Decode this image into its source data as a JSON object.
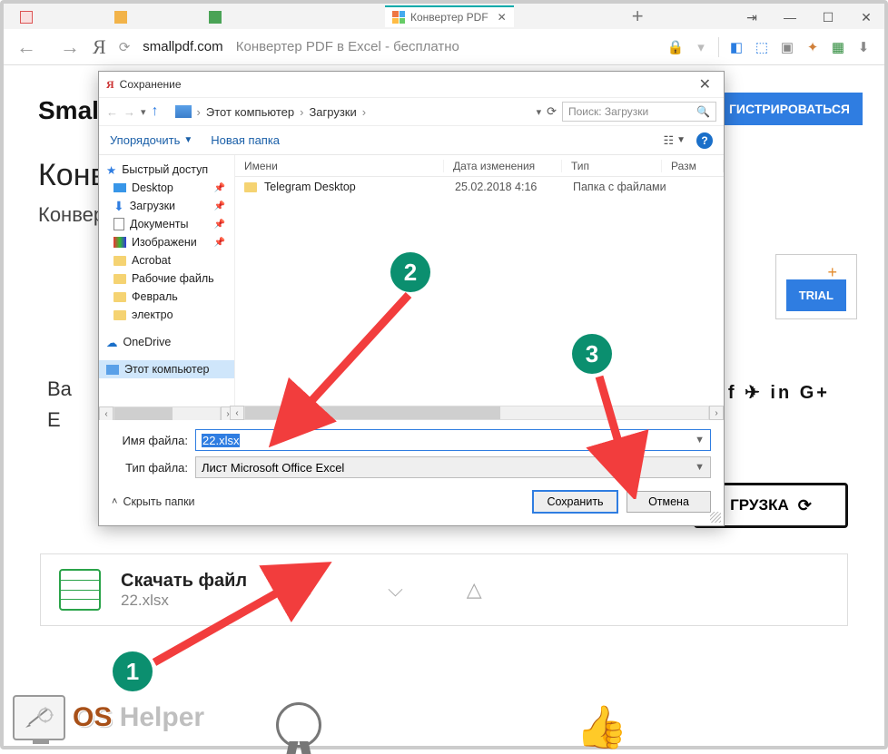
{
  "browser": {
    "active_tab": "Конвертер PDF",
    "url_domain": "smallpdf.com",
    "url_title": "Конвертер PDF в Excel - бесплатно",
    "window_controls": {
      "arrows": "↹",
      "min": "—",
      "max": "☐",
      "close": "✕"
    }
  },
  "page": {
    "brand": "Smallp",
    "register": "ГИСТРИРОВАТЬСЯ",
    "headline": "Конв",
    "subline": "Конвер",
    "trial": "TRIAL",
    "conv_label_1": "Ва",
    "conv_label_2": "E",
    "social": "f ✈ in G+",
    "load": "ГРУЗКА",
    "dl_title": "Скачать файл",
    "dl_file": "22.xlsx"
  },
  "dialog": {
    "title": "Сохранение",
    "breadcrumb": {
      "root": "Этот компьютер",
      "folder": "Загрузки"
    },
    "search_placeholder": "Поиск: Загрузки",
    "organize": "Упорядочить",
    "new_folder": "Новая папка",
    "columns": {
      "name": "Имени",
      "date": "Дата изменения",
      "type": "Тип",
      "size": "Разм"
    },
    "row": {
      "name": "Telegram Desktop",
      "date": "25.02.2018 4:16",
      "type": "Папка с файлами"
    },
    "tree": {
      "quick": "Быстрый доступ",
      "desktop": "Desktop",
      "downloads": "Загрузки",
      "documents": "Документы",
      "images": "Изображени",
      "acrobat": "Acrobat",
      "work": "Рабочие файль",
      "feb": "Февраль",
      "electro": "электро",
      "onedrive": "OneDrive",
      "thispc": "Этот компьютер"
    },
    "filename_label": "Имя файла:",
    "filename_value": "22.xlsx",
    "filetype_label": "Тип файла:",
    "filetype_value": "Лист Microsoft Office Excel",
    "hide_folders": "Скрыть папки",
    "save": "Сохранить",
    "cancel": "Отмена"
  },
  "annotations": {
    "c1": "1",
    "c2": "2",
    "c3": "3"
  },
  "watermark": {
    "os": "OS ",
    "helper": "Helper"
  }
}
